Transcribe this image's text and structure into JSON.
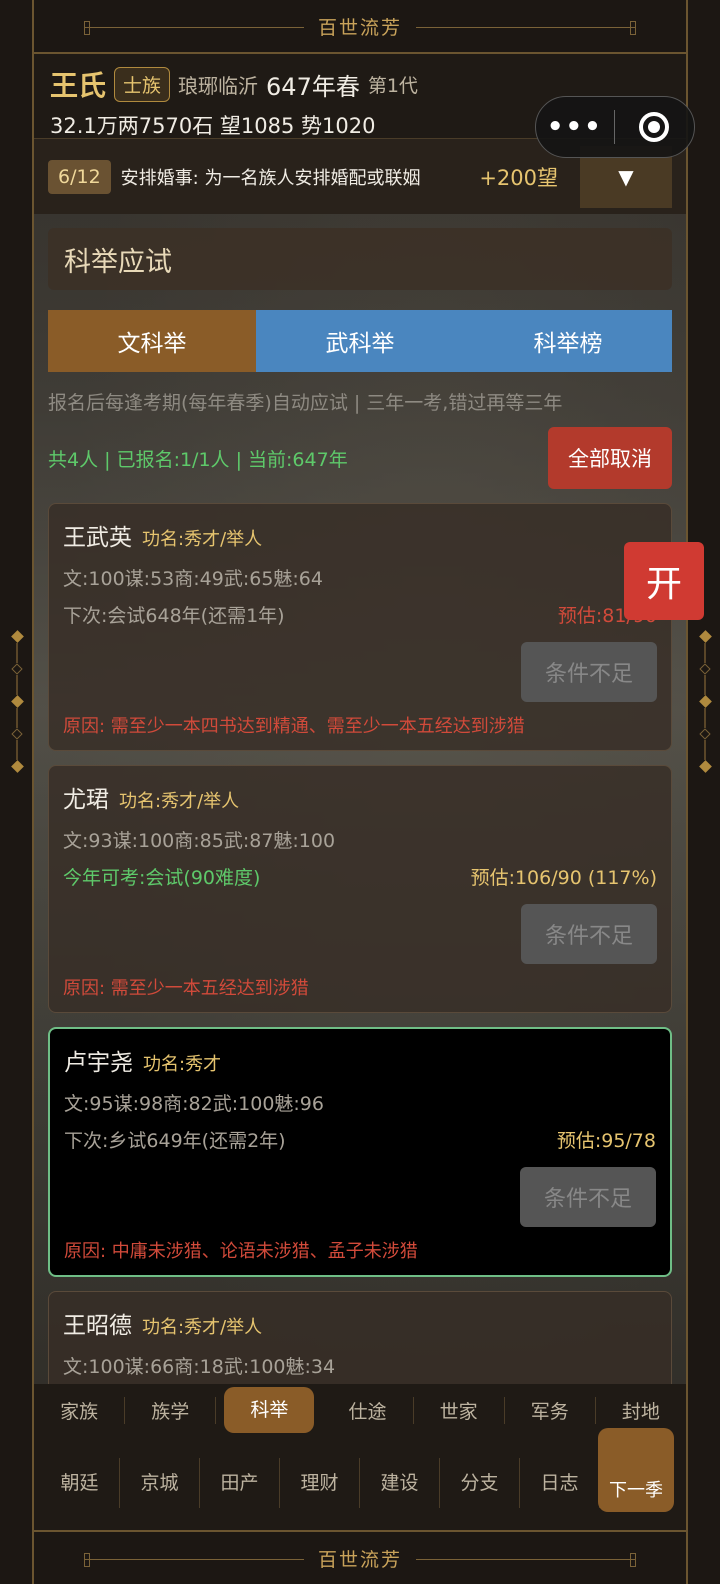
{
  "app_title": "百世流芳",
  "header": {
    "clan": "王氏",
    "rank": "士族",
    "place": "琅琊临沂",
    "year": "647年春",
    "generation": "第1代",
    "resources": "32.1万两7570石  望1085 势1020"
  },
  "task": {
    "count": "6/12",
    "desc": "安排婚事: 为一名族人安排婚配或联姻",
    "reward": "+200望",
    "toggle": "▼"
  },
  "section_title": "科举应试",
  "tabs": [
    {
      "label": "文科举",
      "active": true
    },
    {
      "label": "武科举",
      "active": false
    },
    {
      "label": "科举榜",
      "active": false
    }
  ],
  "tip": "报名后每逢考期(每年春季)自动应试 | 三年一考,错过再等三年",
  "stats": "共4人 | 已报名:1/1人 | 当前:647年",
  "cancel_all": "全部取消",
  "open_btn": "开",
  "cards": [
    {
      "name": "王武英",
      "title": "功名:秀才/举人",
      "attrs": "文:100谋:53商:49武:65魅:64",
      "next": "下次:会试648年(还需1年)",
      "estimate": "预估:81/90",
      "button": "条件不足",
      "reason": "原因: 需至少一本四书达到精通、需至少一本五经达到涉猎"
    },
    {
      "name": "尤珺",
      "title": "功名:秀才/举人",
      "attrs": "文:93谋:100商:85武:87魅:100",
      "next": "今年可考:会试(90难度)",
      "estimate": "预估:106/90 (117%)",
      "button": "条件不足",
      "reason": "原因: 需至少一本五经达到涉猎"
    },
    {
      "name": "卢宇尧",
      "title": "功名:秀才",
      "attrs": "文:95谋:98商:82武:100魅:96",
      "next": "下次:乡试649年(还需2年)",
      "estimate": "预估:95/78",
      "button": "条件不足",
      "reason": "原因: 中庸未涉猎、论语未涉猎、孟子未涉猎"
    },
    {
      "name": "王昭德",
      "title": "功名:秀才/举人",
      "attrs": "文:100谋:66商:18武:100魅:34"
    }
  ],
  "nav_top": [
    "家族",
    "族学",
    "科举",
    "仕途",
    "世家",
    "军务",
    "封地"
  ],
  "nav_bottom": [
    "朝廷",
    "京城",
    "田产",
    "理财",
    "建设",
    "分支",
    "日志"
  ],
  "next_season": "下一季"
}
